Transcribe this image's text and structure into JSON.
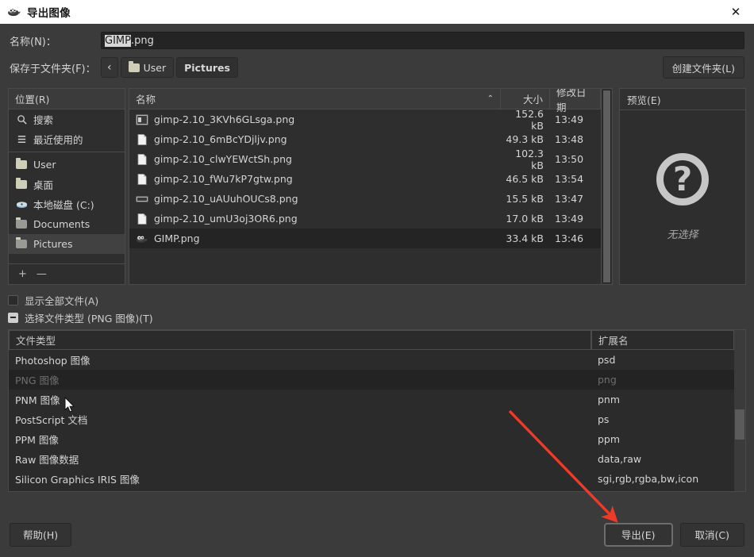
{
  "window": {
    "title": "导出图像",
    "icon": "wilber-icon",
    "close_label": "✕"
  },
  "form": {
    "name_label": "名称(N)：",
    "name_value_selected": "GIMP",
    "name_value_rest": ".png",
    "folder_label": "保存于文件夹(F)：",
    "back_glyph": "‹",
    "crumbs": [
      {
        "label": "User",
        "icon": "folder-icon",
        "current": false
      },
      {
        "label": "Pictures",
        "icon": "",
        "current": true
      }
    ],
    "create_folder_label": "创建文件夹(L)"
  },
  "places": {
    "header": "位置(R)",
    "items": [
      {
        "label": "搜索",
        "icon": "search-icon",
        "selected": false
      },
      {
        "label": "最近使用的",
        "icon": "recent-icon",
        "selected": false
      },
      {
        "label": "User",
        "icon": "folder-icon",
        "selected": false
      },
      {
        "label": "桌面",
        "icon": "folder-icon",
        "selected": false
      },
      {
        "label": "本地磁盘 (C:)",
        "icon": "drive-icon",
        "selected": false
      },
      {
        "label": "Documents",
        "icon": "folder-grey-icon",
        "selected": false
      },
      {
        "label": "Pictures",
        "icon": "folder-grey-icon",
        "selected": true
      }
    ],
    "add_label": "+",
    "remove_label": "—"
  },
  "filelist": {
    "columns": {
      "name": "名称",
      "size": "大小",
      "date": "修改日期"
    },
    "sort_caret": "⌃",
    "rows": [
      {
        "name": "gimp-2.10_3KVh6GLsga.png",
        "size": "152.6 kB",
        "date": "13:49",
        "icon": "thumbnail-icon",
        "selected": false
      },
      {
        "name": "gimp-2.10_6mBcYDjljv.png",
        "size": "49.3 kB",
        "date": "13:48",
        "icon": "document-icon",
        "selected": false
      },
      {
        "name": "gimp-2.10_clwYEWctSh.png",
        "size": "102.3 kB",
        "date": "13:50",
        "icon": "document-icon",
        "selected": false
      },
      {
        "name": "gimp-2.10_fWu7kP7gtw.png",
        "size": "46.5 kB",
        "date": "13:54",
        "icon": "document-icon",
        "selected": false
      },
      {
        "name": "gimp-2.10_uAUuhOUCs8.png",
        "size": "15.5 kB",
        "date": "13:47",
        "icon": "wide-thumbnail-icon",
        "selected": false
      },
      {
        "name": "gimp-2.10_umU3oj3OR6.png",
        "size": "17.0 kB",
        "date": "13:49",
        "icon": "document-icon",
        "selected": false
      },
      {
        "name": "GIMP.png",
        "size": "33.4 kB",
        "date": "13:46",
        "icon": "wilber-icon",
        "selected": true
      }
    ]
  },
  "preview": {
    "header": "预览(E)",
    "placeholder_glyph": "?",
    "empty_text": "无选择"
  },
  "options": {
    "show_all_files": "显示全部文件(A)",
    "show_all_files_checked": false,
    "select_file_type": "选择文件类型 (PNG 图像)(T)",
    "select_file_type_expanded": true
  },
  "filetypes": {
    "columns": {
      "type": "文件类型",
      "extension": "扩展名"
    },
    "rows": [
      {
        "type": "Photoshop 图像",
        "ext": "psd",
        "disabled": false
      },
      {
        "type": "PNG 图像",
        "ext": "png",
        "disabled": true
      },
      {
        "type": "PNM 图像",
        "ext": "pnm",
        "disabled": false
      },
      {
        "type": "PostScript 文档",
        "ext": "ps",
        "disabled": false
      },
      {
        "type": "PPM 图像",
        "ext": "ppm",
        "disabled": false
      },
      {
        "type": "Raw 图像数据",
        "ext": "data,raw",
        "disabled": false
      },
      {
        "type": "Silicon Graphics IRIS 图像",
        "ext": "sgi,rgb,rgba,bw,icon",
        "disabled": false
      }
    ]
  },
  "footer": {
    "help_label": "帮助(H)",
    "export_label": "导出(E)",
    "cancel_label": "取消(C)"
  },
  "colors": {
    "annotation_arrow": "#f03a28",
    "dialog_bg": "#3b3b3b",
    "list_bg": "#2e2e2e",
    "focus_border": "#6d6d6d"
  }
}
